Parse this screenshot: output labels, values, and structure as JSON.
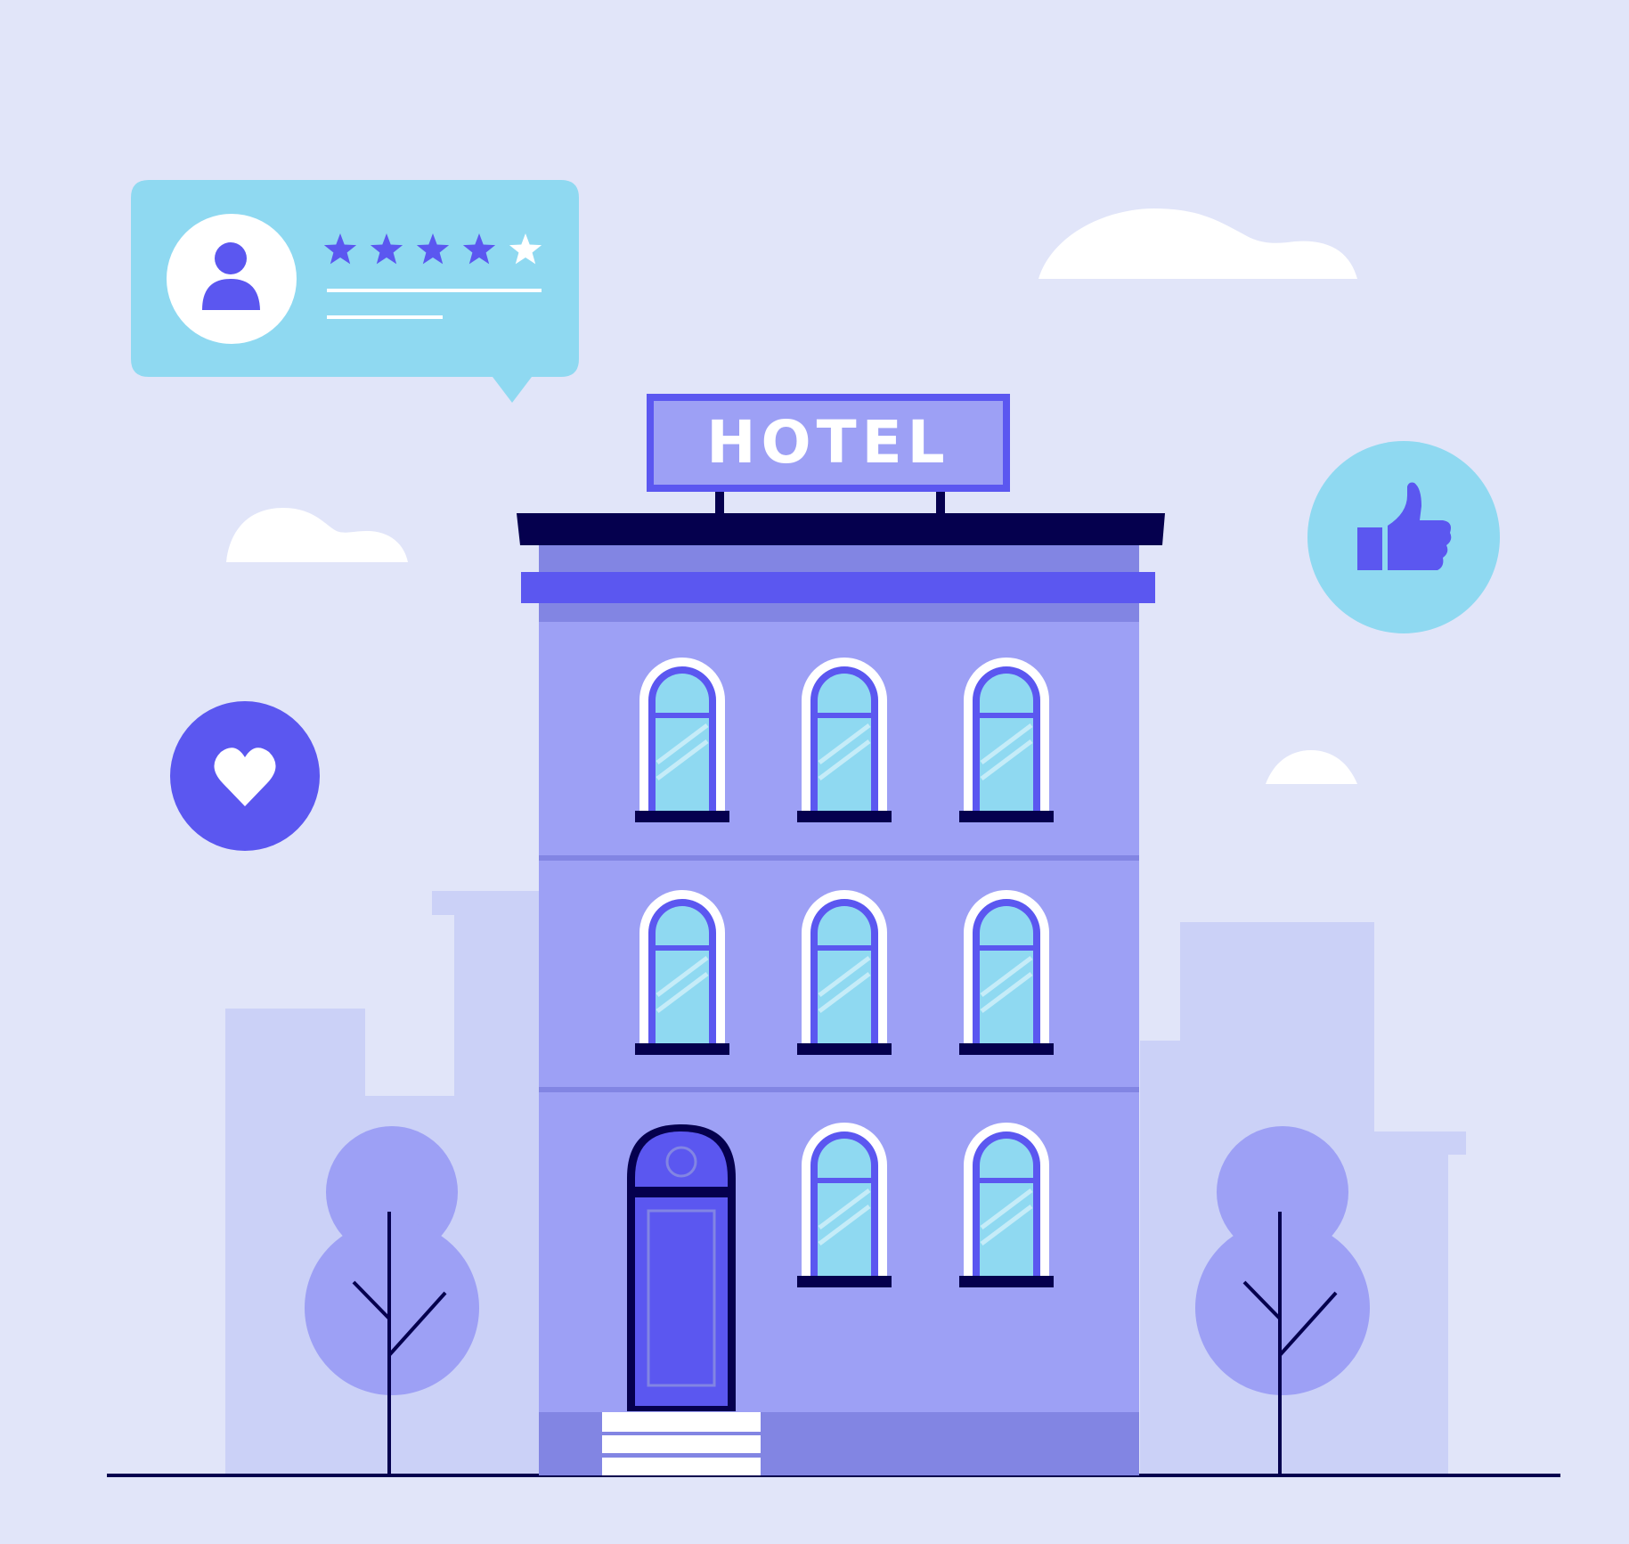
{
  "colors": {
    "background": "#e1e5f9",
    "skyline": "#cbd1f7",
    "building": "#9da0f5",
    "building_shade": "#8285e3",
    "accent": "#5b57f0",
    "dark": "#05004e",
    "glass": "#8fd9f1",
    "white": "#ffffff"
  },
  "sign": {
    "text": "HOTEL"
  },
  "review": {
    "rating": 4,
    "max_rating": 5,
    "icons": {
      "avatar": "user-icon",
      "star": "star-icon"
    }
  },
  "badges": {
    "like": {
      "icon": "thumbs-up-icon"
    },
    "favorite": {
      "icon": "heart-icon"
    }
  }
}
